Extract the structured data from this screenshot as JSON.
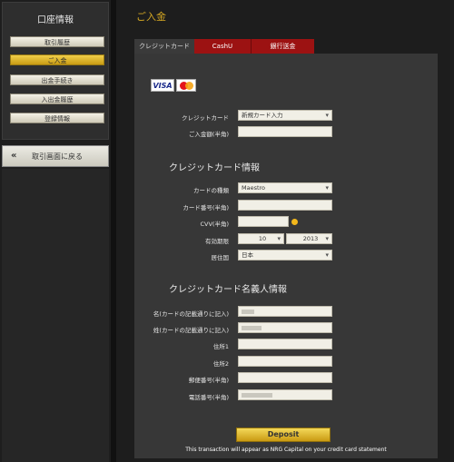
{
  "sidebar": {
    "title": "口座情報",
    "items": [
      {
        "label": "取引履歴",
        "active": false
      },
      {
        "label": "ご入金",
        "active": true
      },
      {
        "label": "出金手続き",
        "active": false
      },
      {
        "label": "入出金履歴",
        "active": false
      },
      {
        "label": "登録情報",
        "active": false
      }
    ],
    "back_arrows": "«",
    "back_label": "取引画面に戻る"
  },
  "page": {
    "title": "ご入金"
  },
  "tabs": [
    {
      "label": "クレジットカード",
      "active": true
    },
    {
      "label": "CashU",
      "active": false
    },
    {
      "label": "銀行送金",
      "active": false
    }
  ],
  "logos": {
    "visa": "VISA"
  },
  "form": {
    "credit_card_label": "クレジットカード",
    "credit_card_value": "新規カード入力",
    "amount_label": "ご入金額(半角)",
    "amount_value": "",
    "card_info_heading": "クレジットカード情報",
    "card_type_label": "カードの種類",
    "card_type_value": "Maestro",
    "card_number_label": "カード番号(半角)",
    "card_number_value": "",
    "cvv_label": "CVV(半角)",
    "cvv_value": "",
    "expiry_label": "有効期限",
    "expiry_month": "10",
    "expiry_year": "2013",
    "country_label": "居住国",
    "country_value": "日本",
    "holder_heading": "クレジットカード名義人情報",
    "first_name_label": "名(カードの記載通りに記入)",
    "last_name_label": "姓(カードの記載通りに記入)",
    "address1_label": "住所1",
    "address2_label": "住所2",
    "zip_label": "郵便番号(半角)",
    "phone_label": "電話番号(半角)"
  },
  "deposit_button": "Deposit",
  "statement_note": "This transaction will appear as NRG Capital on your credit card statement",
  "colors": {
    "accent": "#d4a723",
    "tab_red": "#9c1212",
    "active_gold": "#e2b42a"
  }
}
